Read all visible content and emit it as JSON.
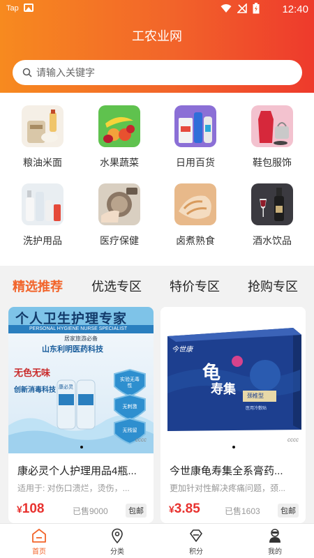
{
  "status_bar": {
    "carrier": "Tap",
    "time": "12:40"
  },
  "header": {
    "title": "工农业网"
  },
  "search": {
    "placeholder": "请输入关键字"
  },
  "categories": [
    {
      "label": "粮油米面",
      "icon": "grain-oil-icon"
    },
    {
      "label": "水果蔬菜",
      "icon": "fruit-icon"
    },
    {
      "label": "日用百货",
      "icon": "daily-goods-icon"
    },
    {
      "label": "鞋包服饰",
      "icon": "clothing-icon"
    },
    {
      "label": "洗护用品",
      "icon": "toiletries-icon"
    },
    {
      "label": "医疗保健",
      "icon": "medical-icon"
    },
    {
      "label": "卤煮熟食",
      "icon": "cooked-food-icon"
    },
    {
      "label": "酒水饮品",
      "icon": "drinks-icon"
    }
  ],
  "tabs": [
    {
      "label": "精选推荐",
      "active": true
    },
    {
      "label": "优选专区"
    },
    {
      "label": "特价专区"
    },
    {
      "label": "抢购专区"
    }
  ],
  "products": [
    {
      "name": "康必灵个人护理用品4瓶...",
      "desc": "适用于: 对伤口溃烂，烫伤，...",
      "price_currency": "¥",
      "price": "108",
      "sold": "已售9000",
      "shipping": "包邮",
      "image_tag": "cccc",
      "image_text": {
        "headline": "个人卫生护理专家",
        "sub_en": "PERSONAL HYGIENE NURSE SPECIALIST",
        "sub_cn": "居家旅游必备",
        "company": "山东利明医药科技",
        "line1": "无色无味",
        "line2": "创新消毒科技",
        "badge1": "实验无毒性",
        "badge2": "无刺激",
        "badge3": "无残留",
        "bottle_brand": "康必灵"
      }
    },
    {
      "name": "今世康龟寿集全系膏药...",
      "desc": "更加针对性解决疼痛问题，颈...",
      "price_currency": "¥",
      "price": "3.85",
      "sold": "已售1603",
      "shipping": "包邮",
      "image_tag": "cccc",
      "image_text": {
        "brand": "今世康",
        "product_a": "龟",
        "product_b": "寿集",
        "label": "颈椎型",
        "sub": "医用冷敷贴"
      }
    }
  ],
  "bottom_nav": [
    {
      "label": "首页",
      "icon": "home-icon",
      "active": true
    },
    {
      "label": "分类",
      "icon": "location-pin-icon"
    },
    {
      "label": "积分",
      "icon": "diamond-icon"
    },
    {
      "label": "我的",
      "icon": "user-icon"
    }
  ],
  "colors": {
    "accent": "#f2642a",
    "price": "#e8322f",
    "header_start": "#f78a1f",
    "header_end": "#ee3a2c"
  }
}
